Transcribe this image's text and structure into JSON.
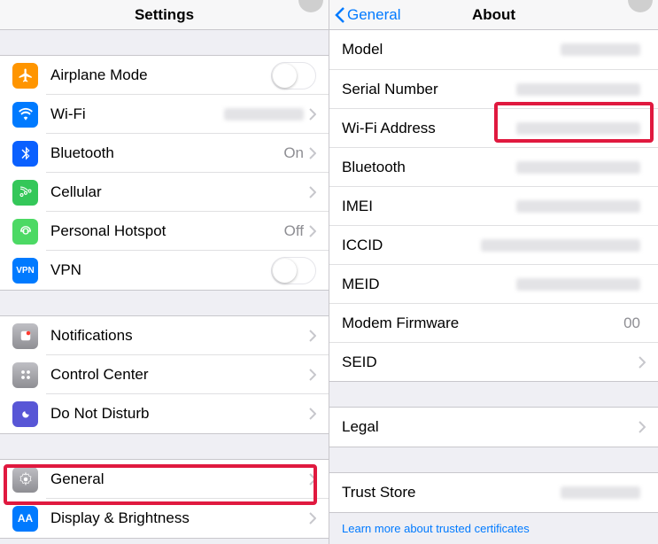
{
  "left": {
    "title": "Settings",
    "group1": [
      {
        "id": "airplane",
        "label": "Airplane Mode",
        "type": "switch"
      },
      {
        "id": "wifi",
        "label": "Wi-Fi",
        "value_blur": true,
        "chevron": true
      },
      {
        "id": "bluetooth",
        "label": "Bluetooth",
        "value": "On",
        "chevron": true
      },
      {
        "id": "cellular",
        "label": "Cellular",
        "chevron": true
      },
      {
        "id": "hotspot",
        "label": "Personal Hotspot",
        "value": "Off",
        "chevron": true
      },
      {
        "id": "vpn",
        "label": "VPN",
        "type": "switch"
      }
    ],
    "group2": [
      {
        "id": "notifications",
        "label": "Notifications",
        "chevron": true
      },
      {
        "id": "controlcenter",
        "label": "Control Center",
        "chevron": true
      },
      {
        "id": "dnd",
        "label": "Do Not Disturb",
        "chevron": true
      }
    ],
    "group3": [
      {
        "id": "general",
        "label": "General",
        "chevron": true
      },
      {
        "id": "display",
        "label": "Display & Brightness",
        "chevron": true
      }
    ]
  },
  "right": {
    "back": "General",
    "title": "About",
    "group1": [
      {
        "id": "model",
        "label": "Model",
        "blur": "sm"
      },
      {
        "id": "serial",
        "label": "Serial Number",
        "blur": "md"
      },
      {
        "id": "wifiaddr",
        "label": "Wi-Fi Address",
        "blur": "md"
      },
      {
        "id": "bluetooth2",
        "label": "Bluetooth",
        "blur": "md"
      },
      {
        "id": "imei",
        "label": "IMEI",
        "blur": "md"
      },
      {
        "id": "iccid",
        "label": "ICCID",
        "blur": "lg"
      },
      {
        "id": "meid",
        "label": "MEID",
        "blur": "md"
      },
      {
        "id": "modem",
        "label": "Modem Firmware",
        "value": "00"
      },
      {
        "id": "seid",
        "label": "SEID",
        "chevron": true
      }
    ],
    "group2": [
      {
        "id": "legal",
        "label": "Legal",
        "chevron": true
      }
    ],
    "group3": [
      {
        "id": "truststore",
        "label": "Trust Store",
        "blur": "sm"
      }
    ],
    "link": "Learn more about trusted certificates"
  }
}
